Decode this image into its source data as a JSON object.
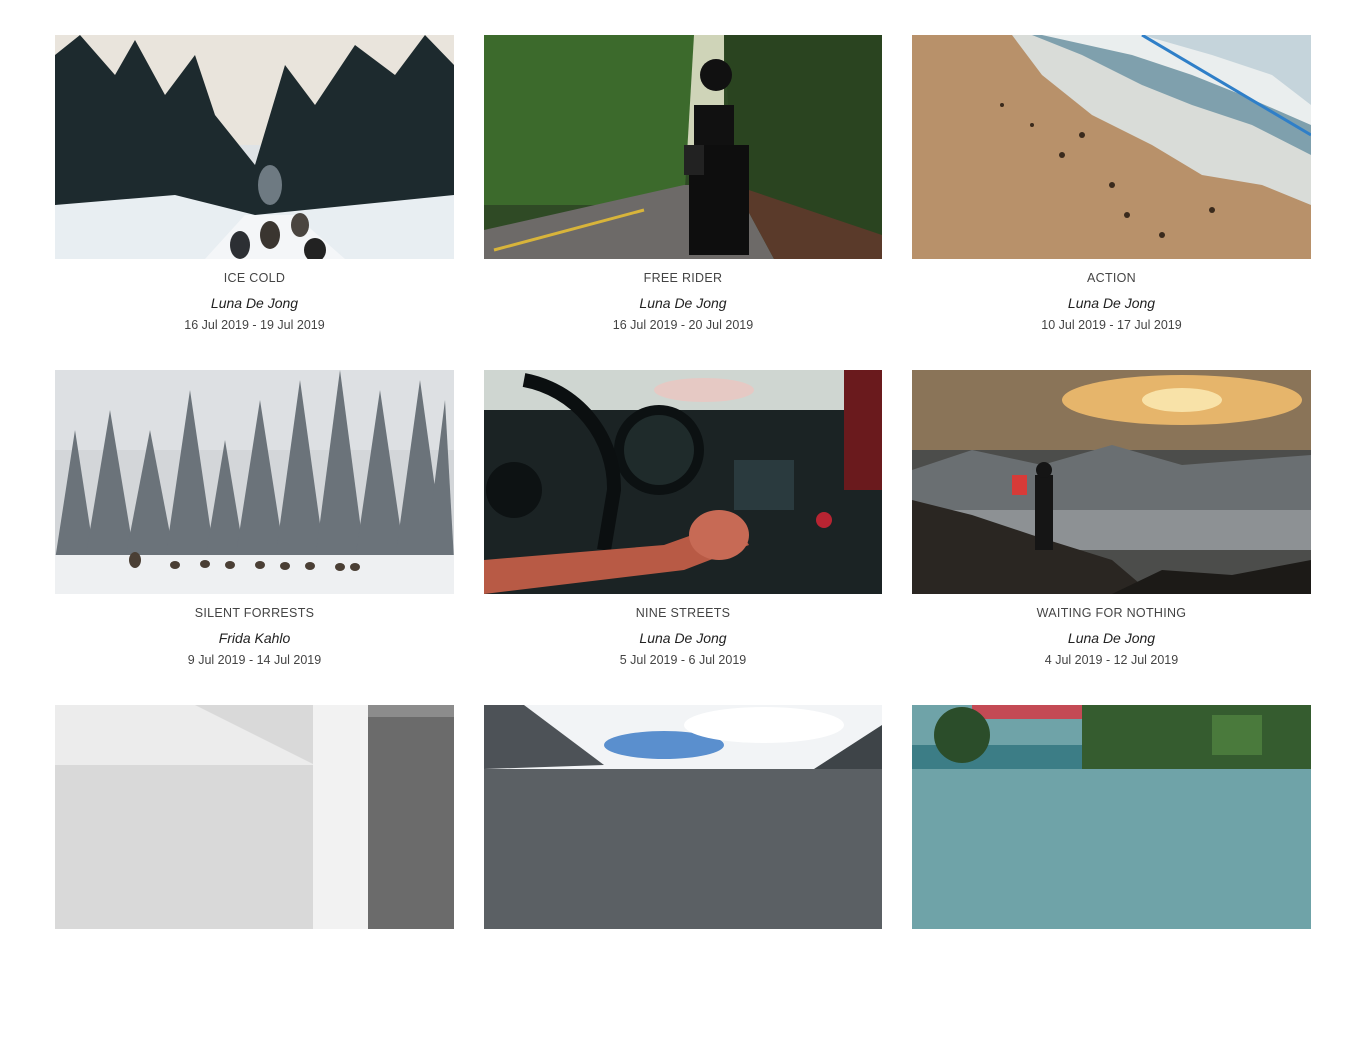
{
  "gallery": {
    "items": [
      {
        "title": "ICE COLD",
        "author": "Luna De Jong",
        "dates": "16 Jul 2019 - 19 Jul 2019",
        "image": "snowy-forest-sled-dogs"
      },
      {
        "title": "FREE RIDER",
        "author": "Luna De Jong",
        "dates": "16 Jul 2019 - 20 Jul 2019",
        "image": "motorcyclist-forest-road"
      },
      {
        "title": "ACTION",
        "author": "Luna De Jong",
        "dates": "10 Jul 2019 - 17 Jul 2019",
        "image": "aerial-beach-waves"
      },
      {
        "title": "SILENT FORRESTS",
        "author": "Frida Kahlo",
        "dates": "9 Jul 2019 - 14 Jul 2019",
        "image": "snowy-forest-dog-sled-team"
      },
      {
        "title": "NINE STREETS",
        "author": "Luna De Jong",
        "dates": "5 Jul 2019 - 6 Jul 2019",
        "image": "car-dashboard-steering-wheel"
      },
      {
        "title": "WAITING FOR NOTHING",
        "author": "Luna De Jong",
        "dates": "4 Jul 2019 - 12 Jul 2019",
        "image": "hiker-with-flag-mountain-sunset"
      },
      {
        "title": "",
        "author": "",
        "dates": "",
        "image": "black-white-architecture"
      },
      {
        "title": "",
        "author": "",
        "dates": "",
        "image": "mountains-blue-sky"
      },
      {
        "title": "",
        "author": "",
        "dates": "",
        "image": "tropical-building-palms"
      }
    ]
  }
}
